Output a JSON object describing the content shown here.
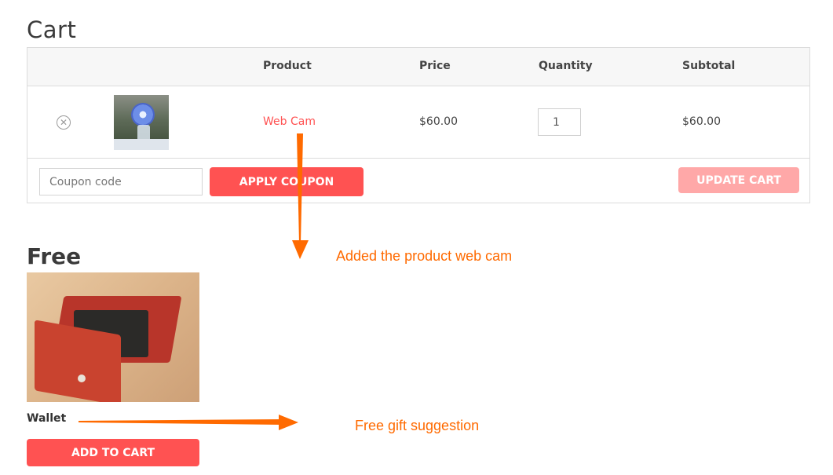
{
  "page": {
    "title": "Cart"
  },
  "cart_table": {
    "headers": {
      "product": "Product",
      "price": "Price",
      "quantity": "Quantity",
      "subtotal": "Subtotal"
    },
    "rows": [
      {
        "product": "Web Cam",
        "price": "$60.00",
        "quantity": "1",
        "subtotal": "$60.00",
        "remove_icon": "remove-circle-icon"
      }
    ]
  },
  "actions": {
    "coupon_placeholder": "Coupon code",
    "apply_coupon": "Apply coupon",
    "update_cart": "Update cart"
  },
  "free_section": {
    "title": "Free",
    "product": {
      "name": "Wallet",
      "button": "Add to cart"
    }
  },
  "annotations": {
    "added_product": "Added the product  web cam",
    "free_gift": "Free gift suggestion"
  },
  "colors": {
    "accent": "#ff5252",
    "accent_disabled": "#ffa8a8",
    "annotation": "#ff6a00"
  }
}
